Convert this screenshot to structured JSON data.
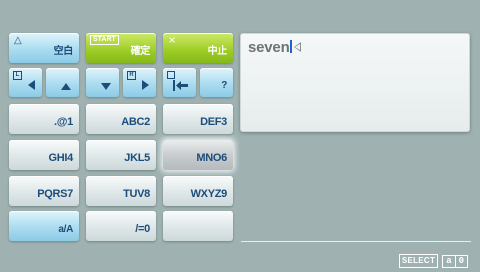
{
  "keypad": {
    "row1": {
      "space": {
        "corner": "△",
        "label": "空白"
      },
      "confirm": {
        "tag": "START",
        "label": "確定"
      },
      "cancel": {
        "corner": "×",
        "label": "中止"
      }
    },
    "row2": {
      "left": {
        "tag": "L"
      },
      "right": {
        "tag": "R"
      },
      "help": {
        "label": "?"
      }
    },
    "keys": [
      ".@1",
      "ABC2",
      "DEF3",
      "GHI4",
      "JKL5",
      "MNO6",
      "PQRS7",
      "TUV8",
      "WXYZ9",
      "a/A",
      "/=0",
      ""
    ]
  },
  "textbox": {
    "value": "seven"
  },
  "status": {
    "select_label": "SELECT",
    "mode_left": "a",
    "mode_right": "0"
  },
  "colors": {
    "background": "#9fb1b1",
    "key_text": "#1c4d7a",
    "green_key": "#9ccc24",
    "blue_key": "#aadcf0",
    "caret": "#2060d0"
  },
  "icons": [
    "triangle-icon",
    "cross-icon",
    "arrow-left-icon",
    "arrow-up-icon",
    "arrow-down-icon",
    "arrow-right-icon",
    "square-icon",
    "backspace-icon"
  ]
}
